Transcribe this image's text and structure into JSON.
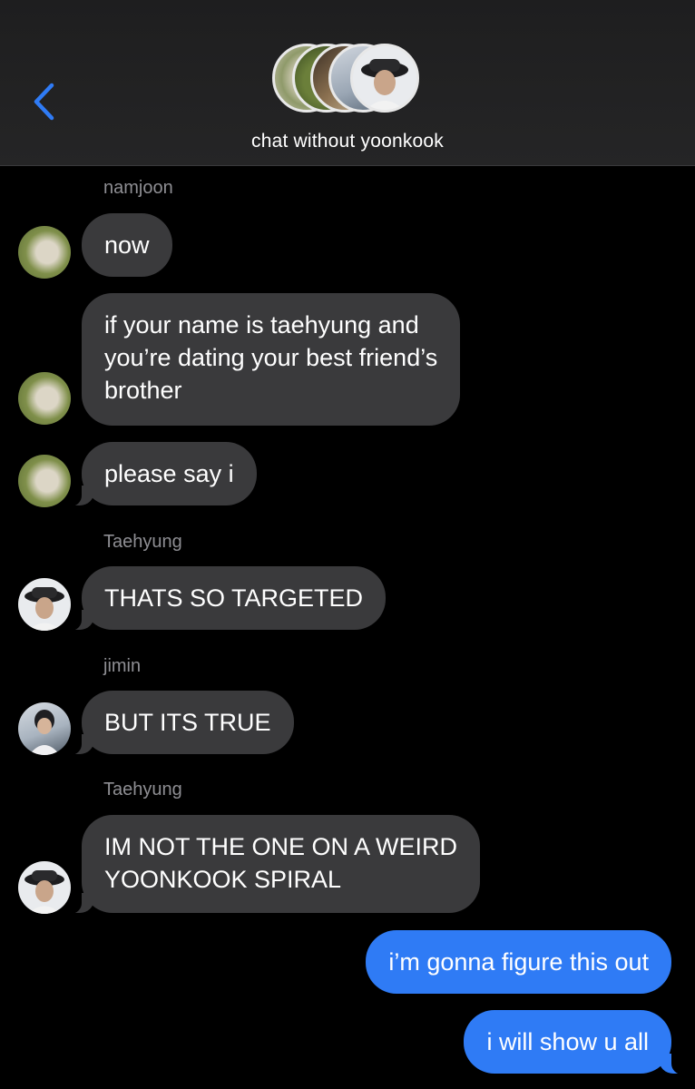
{
  "header": {
    "title": "chat without yoonkook",
    "back_icon": "chevron-left-icon",
    "accent": "#2f7bf5"
  },
  "messages": [
    {
      "sender": "namjoon",
      "text": "now"
    },
    {
      "sender": "namjoon",
      "text": "if your name is taehyung and\nyou’re dating your best friend’s\nbrother"
    },
    {
      "sender": "namjoon",
      "text": "please say i"
    },
    {
      "sender": "Taehyung",
      "text": "THATS SO TARGETED"
    },
    {
      "sender": "jimin",
      "text": "BUT ITS TRUE"
    },
    {
      "sender": "Taehyung",
      "text": "IM NOT THE ONE ON A WEIRD\nYOONKOOK SPIRAL"
    },
    {
      "sender": "me",
      "text": "i’m gonna figure this out"
    },
    {
      "sender": "me",
      "text": "i will show u all"
    }
  ],
  "colors": {
    "received_bubble": "#3a3a3c",
    "sent_bubble": "#2f7bf5",
    "background": "#000000",
    "sender_label": "#8e8e93"
  }
}
